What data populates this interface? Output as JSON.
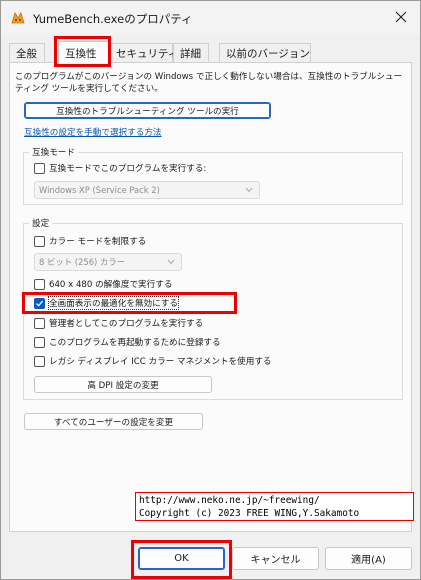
{
  "window": {
    "title": "YumeBench.exeのプロパティ"
  },
  "tabs": [
    {
      "label": "全般"
    },
    {
      "label": "互換性"
    },
    {
      "label": "セキュリティ"
    },
    {
      "label": "詳細"
    },
    {
      "label": "以前のバージョン"
    }
  ],
  "active_tab": "互換性",
  "description": "このプログラムがこのバージョンの Windows で正しく動作しない場合は、互換性のトラブルシューティング ツールを実行してください。",
  "troubleshooter_button": "互換性のトラブルシューティング ツールの実行",
  "manual_link": "互換性の設定を手動で選択する方法",
  "compat_mode": {
    "group_label": "互換モード",
    "checkbox_label": "互換モードでこのプログラムを実行する:",
    "checked": false,
    "os_select": "Windows XP (Service Pack 2)"
  },
  "settings": {
    "group_label": "設定",
    "reduced_color_label": "カラー モードを制限する",
    "reduced_color_checked": false,
    "color_select": "8 ビット (256) カラー",
    "res_640_label": "640 x 480 の解像度で実行する",
    "res_640_checked": false,
    "fullscreen_opt_label": "全画面表示の最適化を無効にする",
    "fullscreen_opt_checked": true,
    "admin_label": "管理者としてこのプログラムを実行する",
    "admin_checked": false,
    "restart_label": "このプログラムを再起動するために登録する",
    "restart_checked": false,
    "icc_label": "レガシ ディスプレイ ICC カラー マネジメントを使用する",
    "icc_checked": false,
    "dpi_button": "高 DPI 設定の変更"
  },
  "all_users_button": "すべてのユーザーの設定を変更",
  "overlay": {
    "line1": "http://www.neko.ne.jp/~freewing/",
    "line2": "Copyright (c) 2023 FREE WING,Y.Sakamoto"
  },
  "footer": {
    "ok": "OK",
    "cancel": "キャンセル",
    "apply": "適用(A)"
  },
  "colors": {
    "accent": "#0a5cb8",
    "link": "#0a58b4",
    "highlight": "#ee0000"
  }
}
